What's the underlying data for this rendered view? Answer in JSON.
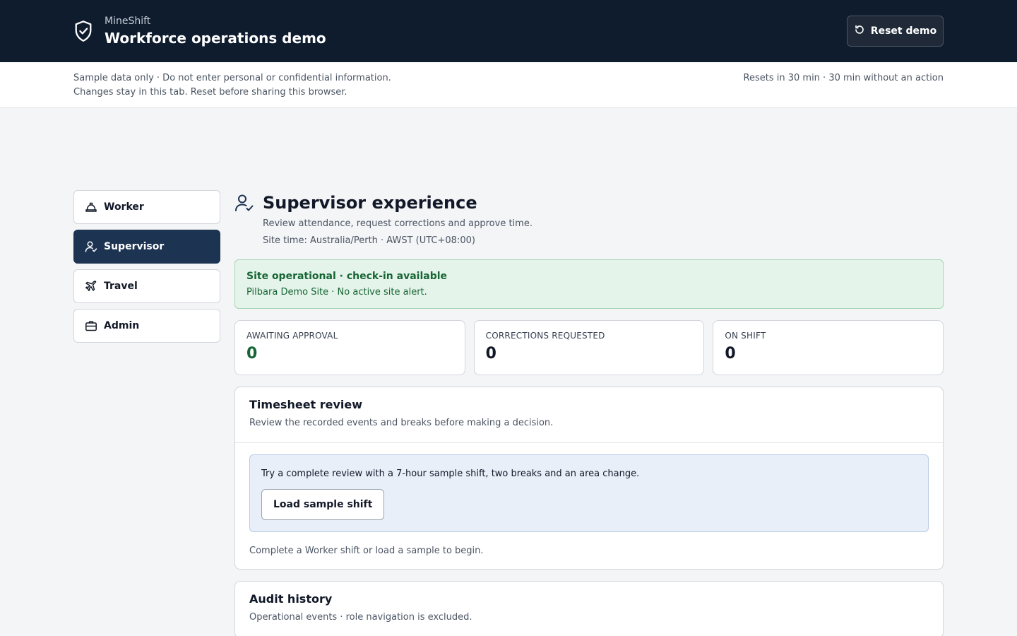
{
  "header": {
    "brand_name": "MineShift",
    "title": "Workforce operations demo",
    "reset_label": "Reset demo"
  },
  "notice": {
    "line1": "Sample data only · Do not enter personal or confidential information.",
    "line2": "Changes stay in this tab. Reset before sharing this browser.",
    "timer": "Resets in 30 min · 30 min without an action"
  },
  "nav": {
    "items": [
      {
        "label": "Worker",
        "icon": "hard-hat-icon"
      },
      {
        "label": "Supervisor",
        "icon": "user-check-icon",
        "active": true
      },
      {
        "label": "Travel",
        "icon": "plane-icon"
      },
      {
        "label": "Admin",
        "icon": "briefcase-icon"
      }
    ]
  },
  "page": {
    "title": "Supervisor experience",
    "subtitle": "Review attendance, request corrections and approve time.",
    "site_time": "Site time: Australia/Perth · AWST (UTC+08:00)"
  },
  "status": {
    "title": "Site operational · check-in available",
    "text": "Pilbara Demo Site · No active site alert."
  },
  "stats": [
    {
      "label": "AWAITING APPROVAL",
      "value": "0"
    },
    {
      "label": "CORRECTIONS REQUESTED",
      "value": "0"
    },
    {
      "label": "ON SHIFT",
      "value": "0"
    }
  ],
  "timesheet": {
    "title": "Timesheet review",
    "subtitle": "Review the recorded events and breaks before making a decision.",
    "hint": "Try a complete review with a 7-hour sample shift, two breaks and an area change.",
    "load_label": "Load sample shift",
    "footer": "Complete a Worker shift or load a sample to begin."
  },
  "audit": {
    "title": "Audit history",
    "subtitle": "Operational events · role navigation is excluded."
  },
  "colors": {
    "topbar": "#0f1c2e",
    "nav_active": "#1c3352",
    "status_green": "#166534"
  }
}
